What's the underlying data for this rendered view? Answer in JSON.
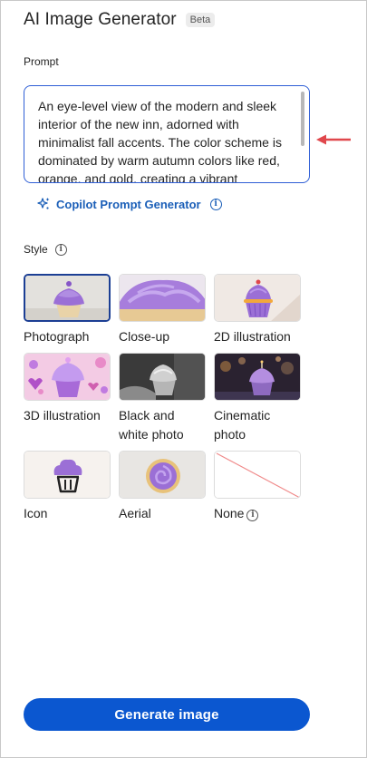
{
  "header": {
    "title": "AI Image Generator",
    "badge": "Beta"
  },
  "prompt": {
    "label": "Prompt",
    "value": "An eye-level view of the modern and sleek interior of the new inn, adorned with minimalist fall accents. The color scheme is dominated by warm autumn colors like red, orange, and gold, creating a vibrant"
  },
  "copilot": {
    "label": "Copilot Prompt Generator"
  },
  "style": {
    "label": "Style",
    "items": [
      {
        "label": "Photograph",
        "selected": true
      },
      {
        "label": "Close-up",
        "selected": false
      },
      {
        "label": "2D illustration",
        "selected": false
      },
      {
        "label": "3D illustration",
        "selected": false
      },
      {
        "label": "Black and white photo",
        "selected": false
      },
      {
        "label": "Cinematic photo",
        "selected": false
      },
      {
        "label": "Icon",
        "selected": false
      },
      {
        "label": "Aerial",
        "selected": false
      },
      {
        "label": "None",
        "selected": false
      }
    ]
  },
  "actions": {
    "generate_label": "Generate image"
  },
  "colors": {
    "accent": "#0b57d0",
    "link": "#1b5fb8",
    "selected_border": "#1c3f94",
    "arrow": "#e0474c",
    "frosting": "#9b6fd6"
  },
  "icons": [
    "sparkle-icon",
    "info-icon",
    "arrow-left-icon"
  ]
}
